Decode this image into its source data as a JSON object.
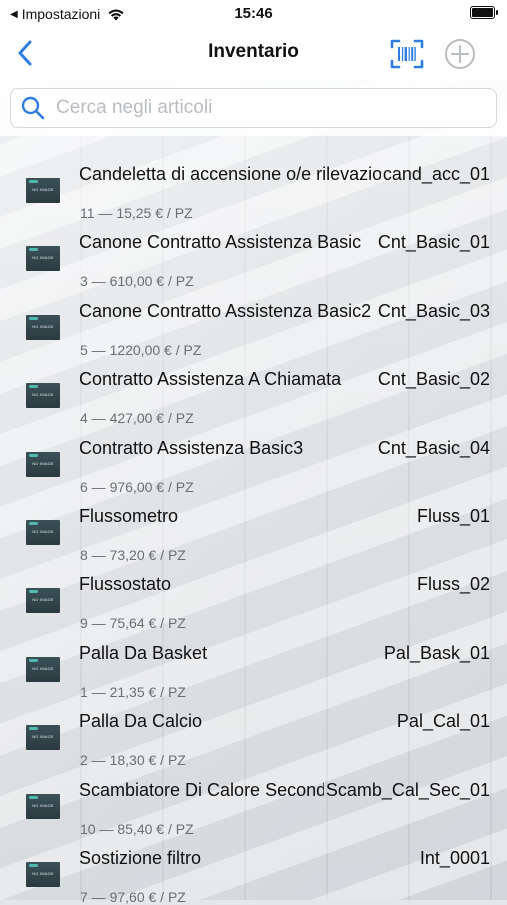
{
  "status_bar": {
    "back_app": "Impostazioni",
    "time": "15:46"
  },
  "nav": {
    "title": "Inventario"
  },
  "search": {
    "placeholder": "Cerca negli articoli"
  },
  "thumb_label": "NO IMAGE",
  "items": [
    {
      "name": "Candeletta di accensione o/e rilevazione",
      "code": "cand_acc_01",
      "detail": "11 — 15,25 € / PZ"
    },
    {
      "name": "Canone Contratto Assistenza Basic",
      "code": "Cnt_Basic_01",
      "detail": "3 — 610,00 € / PZ"
    },
    {
      "name": "Canone Contratto Assistenza Basic2",
      "code": "Cnt_Basic_03",
      "detail": "5 — 1220,00 € / PZ"
    },
    {
      "name": "Contratto Assistenza A Chiamata",
      "code": "Cnt_Basic_02",
      "detail": "4 — 427,00 € / PZ"
    },
    {
      "name": "Contratto Assistenza Basic3",
      "code": "Cnt_Basic_04",
      "detail": "6 — 976,00 € / PZ"
    },
    {
      "name": "Flussometro",
      "code": "Fluss_01",
      "detail": "8 — 73,20 € / PZ"
    },
    {
      "name": "Flussostato",
      "code": "Fluss_02",
      "detail": "9 — 75,64 € / PZ"
    },
    {
      "name": "Palla Da Basket",
      "code": "Pal_Bask_01",
      "detail": "1 — 21,35 € / PZ"
    },
    {
      "name": "Palla Da Calcio",
      "code": "Pal_Cal_01",
      "detail": "2 — 18,30 € / PZ"
    },
    {
      "name": "Scambiatore Di Calore Secondario",
      "code": "Scamb_Cal_Sec_01",
      "detail": "10 — 85,40 € / PZ"
    },
    {
      "name": "Sostizione filtro",
      "code": "Int_0001",
      "detail": "7 — 97,60 € / PZ"
    }
  ],
  "colors": {
    "accent": "#2f7de1"
  }
}
